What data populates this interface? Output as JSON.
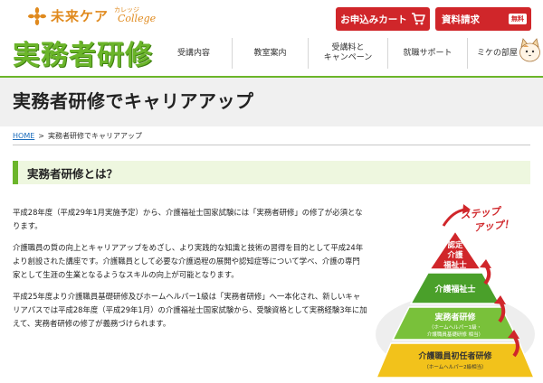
{
  "brand": {
    "logo_text": "未来ケア",
    "logo_sub": "カレッジ",
    "logo_college": "College",
    "course_title": "実務者研修"
  },
  "top_buttons": {
    "cart": "お申込みカート",
    "request": "資料請求",
    "request_badge": "無料"
  },
  "nav": [
    {
      "label": "受講内容"
    },
    {
      "label": "教室案内"
    },
    {
      "line1": "受講料と",
      "line2": "キャンペーン"
    },
    {
      "label": "就職サポート"
    },
    {
      "label": "ミケの部屋"
    }
  ],
  "hero": {
    "title": "実務者研修でキャリアアップ"
  },
  "breadcrumb": {
    "home": "HOME",
    "separator": ">",
    "current": "実務者研修でキャリアアップ"
  },
  "section": {
    "title": "実務者研修とは？",
    "paragraphs": [
      "平成28年度（平成29年1月実施予定）から、介護福祉士国家試験には「実務者研修」の修了が必須となります。",
      "介護職員の質の向上とキャリアアップをめざし、より実践的な知識と技術の習得を目的として平成24年より創設された講座です。介護職員として必要な介護過程の展開や認知症等について学べ、介護の専門家として生涯の生業となるようなスキルの向上が可能となります。",
      "平成25年度より介護職員基礎研修及びホームヘルパー1級は「実務者研修」へ一本化され、新しいキャリアパスでは平成28年度（平成29年1月）の介護福祉士国家試験から、受験資格として実務経験3年に加えて、実務者研修の修了が義務づけられます。"
    ]
  },
  "pyramid": {
    "step_line1": "ステップ",
    "step_line2": "アップ！",
    "levels": [
      {
        "title1": "認定",
        "title2": "介護",
        "title3": "福祉士",
        "color": "#d0262a"
      },
      {
        "title": "介護福祉士",
        "color": "#4aa02a"
      },
      {
        "title": "実務者研修",
        "sub1": "（ホームヘルパー1級・",
        "sub2": "介護職員基礎研修 相当）",
        "color": "#79c13a"
      },
      {
        "title": "介護職員初任者研修",
        "sub": "（ホームヘルパー2級相当）",
        "color": "#f2c21b"
      }
    ]
  },
  "colors": {
    "accent_green": "#6bb52a",
    "brand_orange": "#e08a1e",
    "button_red": "#d0262a",
    "link_blue": "#1a6bbb"
  }
}
